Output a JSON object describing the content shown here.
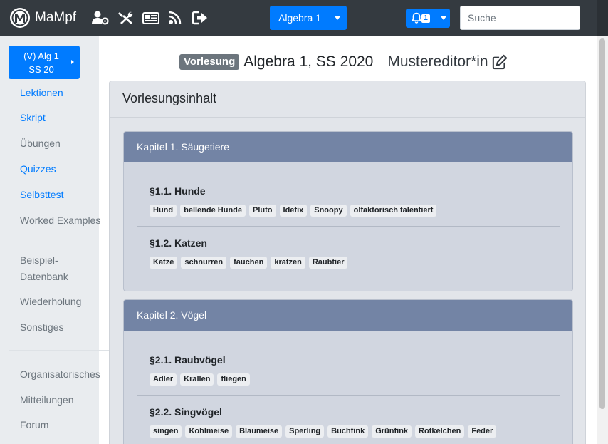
{
  "navbar": {
    "brand": "MaMpf",
    "icons": [
      "user-settings-icon",
      "tools-icon",
      "news-icon",
      "feed-icon",
      "logout-icon"
    ],
    "lecture_dropdown": "Algebra 1",
    "notifications_count": "1",
    "search_placeholder": "Suche",
    "colors": {
      "background": "#343a40",
      "primary": "#007bff"
    }
  },
  "sidebar": {
    "lecture_button": {
      "line1": "(V) Alg 1",
      "line2": "SS 20"
    },
    "items": [
      {
        "label": "Lektionen",
        "link": true
      },
      {
        "label": "Skript",
        "link": true
      },
      {
        "label": "Übungen",
        "link": false
      },
      {
        "label": "Quizzes",
        "link": true
      },
      {
        "label": "Selbsttest",
        "link": true
      },
      {
        "label": "Worked Examples",
        "link": false
      },
      {
        "label": "Beispiel-",
        "link": false
      },
      {
        "label": "Datenbank",
        "link": false
      },
      {
        "label": "Wiederholung",
        "link": false
      },
      {
        "label": "Sonstiges",
        "link": false
      },
      {
        "label": "Organisatorisches",
        "link": false
      },
      {
        "label": "Mitteilungen",
        "link": false
      },
      {
        "label": "Forum",
        "link": false
      }
    ]
  },
  "main": {
    "badge": "Vorlesung",
    "title": "Algebra 1, SS 2020",
    "editor": "Mustereditor*in",
    "card_title": "Vorlesungsinhalt",
    "chapters": [
      {
        "title": "Kapitel 1. Säugetiere",
        "sections": [
          {
            "title": "§1.1. Hunde",
            "tags": [
              "Hund",
              "bellende Hunde",
              "Pluto",
              "Idefix",
              "Snoopy",
              "olfaktorisch talentiert"
            ]
          },
          {
            "title": "§1.2. Katzen",
            "tags": [
              "Katze",
              "schnurren",
              "fauchen",
              "kratzen",
              "Raubtier"
            ]
          }
        ]
      },
      {
        "title": "Kapitel 2. Vögel",
        "sections": [
          {
            "title": "§2.1. Raubvögel",
            "tags": [
              "Adler",
              "Krallen",
              "fliegen"
            ]
          },
          {
            "title": "§2.2. Singvögel",
            "tags": [
              "singen",
              "Kohlmeise",
              "Blaumeise",
              "Sperling",
              "Buchfink",
              "Grünfink",
              "Rotkelchen",
              "Feder"
            ]
          }
        ]
      }
    ]
  }
}
